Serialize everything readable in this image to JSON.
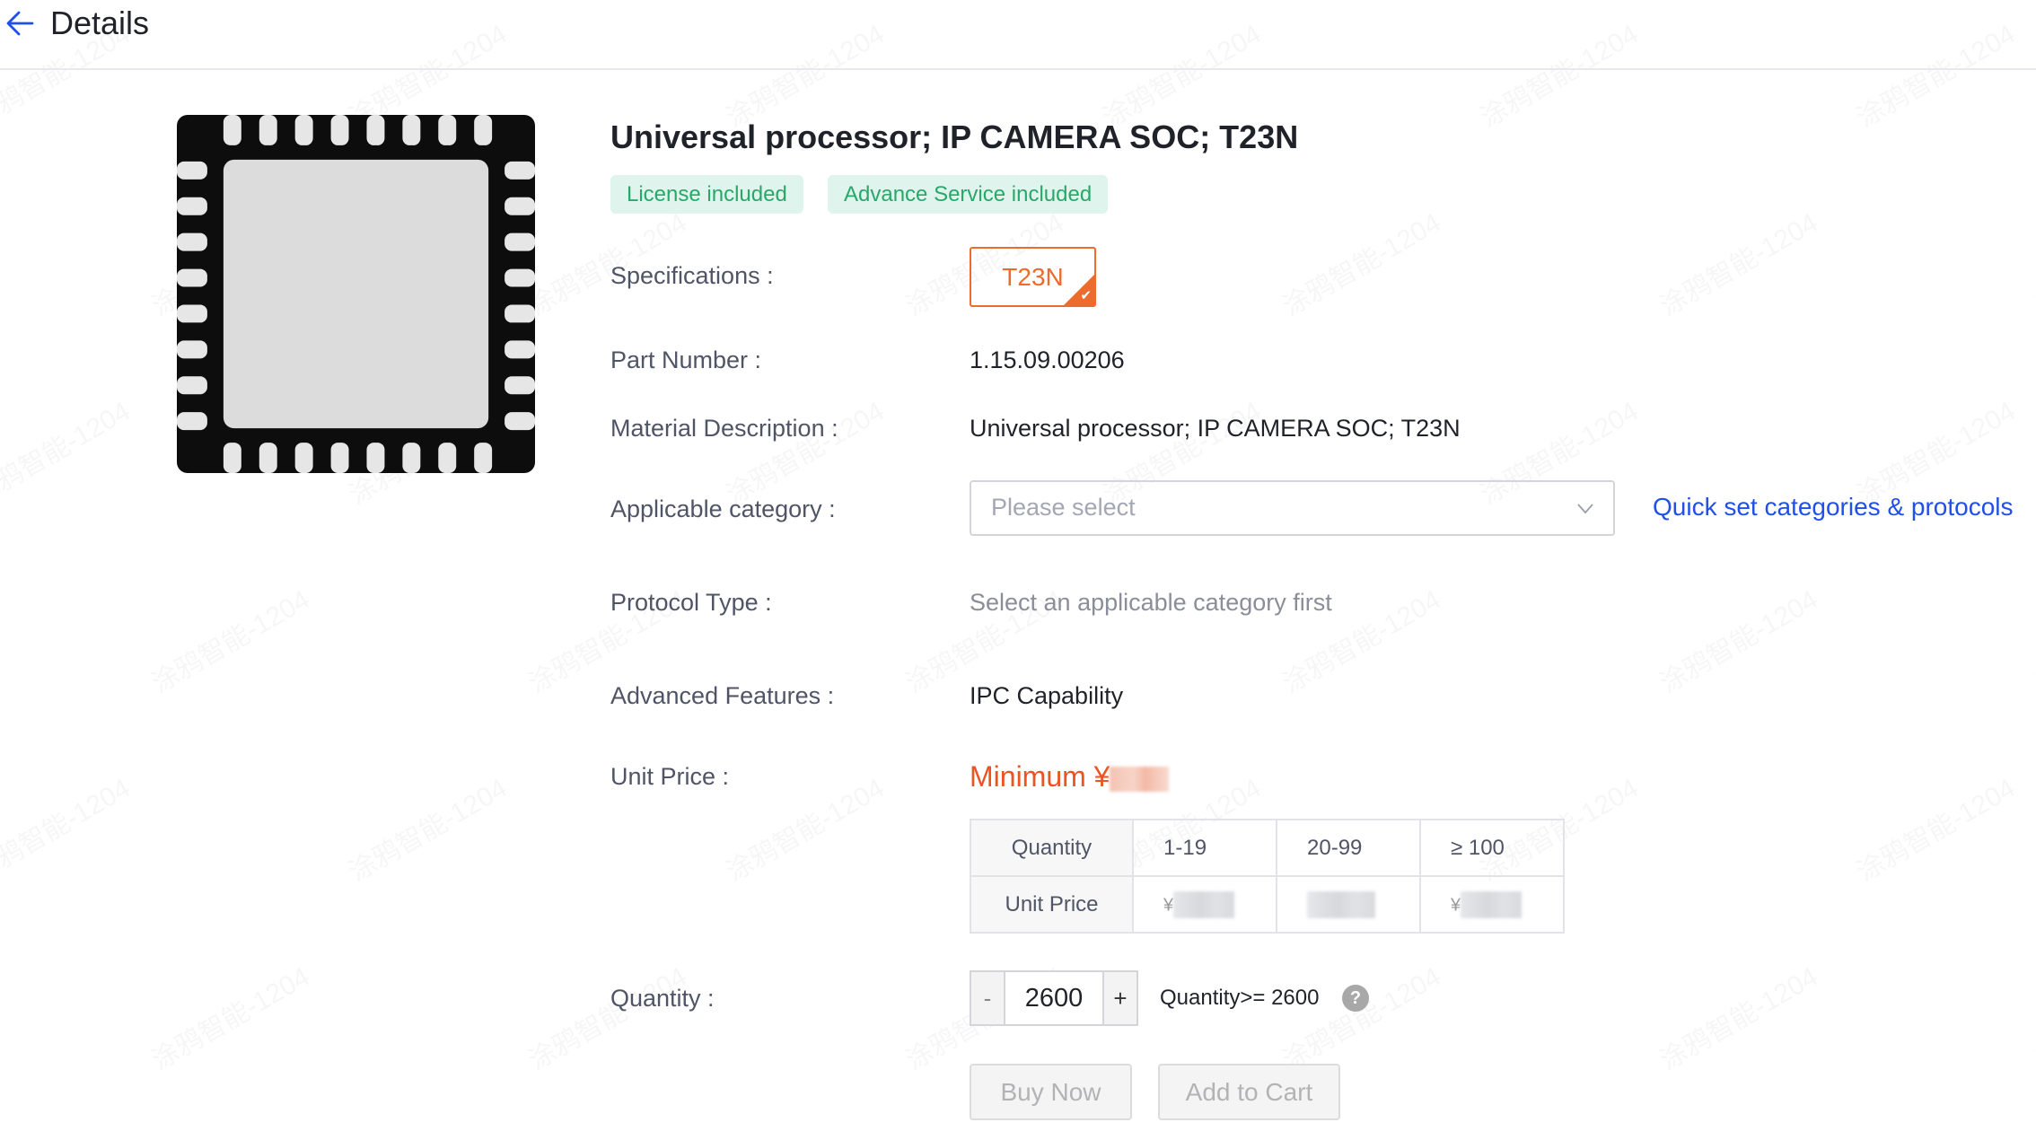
{
  "header": {
    "back_icon": "arrow-left-icon",
    "title": "Details"
  },
  "product": {
    "image": "qfn-chip-image",
    "title": "Universal processor; IP CAMERA SOC; T23N",
    "badges": [
      "License included",
      "Advance Service included"
    ],
    "colors": {
      "accent": "#ec6b2d",
      "price": "#ec5323",
      "link": "#2050e8",
      "badge_bg": "#def4ec",
      "badge_text": "#2aa76a"
    }
  },
  "fields": {
    "specifications": {
      "label": "Specifications :",
      "selected": "T23N",
      "check_icon": "check-icon"
    },
    "part_number": {
      "label": "Part Number :",
      "value": "1.15.09.00206"
    },
    "material_description": {
      "label": "Material Description :",
      "value": "Universal processor; IP CAMERA SOC; T23N"
    },
    "applicable_category": {
      "label": "Applicable category :",
      "placeholder": "Please select",
      "link": "Quick set categories & protocols"
    },
    "protocol_type": {
      "label": "Protocol Type :",
      "value": "Select an applicable category first"
    },
    "advanced_features": {
      "label": "Advanced Features :",
      "value": "IPC Capability"
    },
    "unit_price": {
      "label": "Unit Price :",
      "minimum_prefix": "Minimum ¥"
    }
  },
  "price_table": {
    "row_headers": [
      "Quantity",
      "Unit Price"
    ],
    "quantity_tiers": [
      "1-19",
      "20-99",
      "≥ 100"
    ],
    "prices": [
      "¥(blurred)",
      "(blurred)",
      "¥(blurred)"
    ]
  },
  "quantity": {
    "label": "Quantity :",
    "minus": "-",
    "plus": "+",
    "value": "2600",
    "hint": "Quantity>= 2600",
    "help_icon": "?"
  },
  "actions": {
    "buy_now": "Buy Now",
    "add_to_cart": "Add to Cart"
  },
  "watermark": "涂鸦智能-1204"
}
